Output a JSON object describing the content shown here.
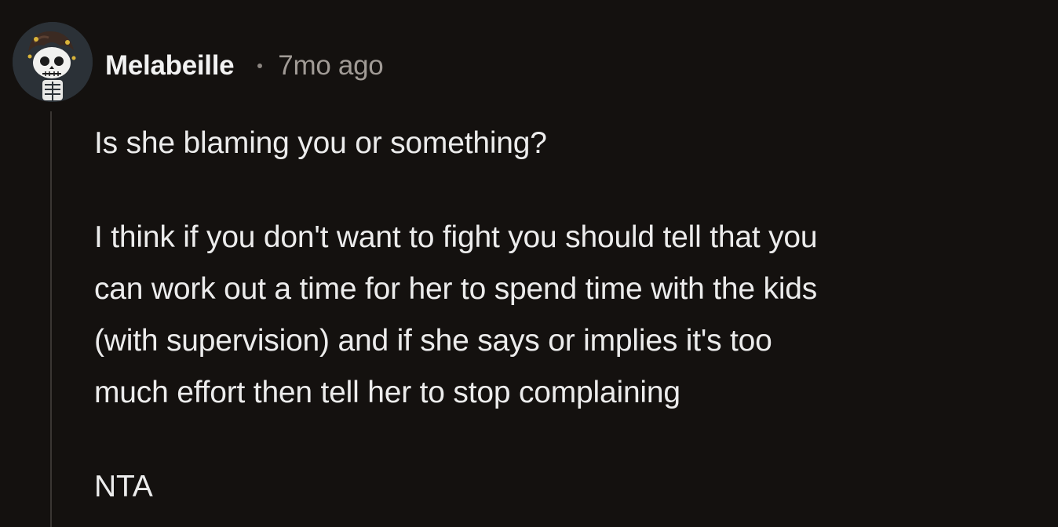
{
  "comment": {
    "author": "Melabeille",
    "age": "7mo ago",
    "lines": {
      "l1": "Is she blaming you or something?",
      "l2": "I think if you don't want to fight you should tell that you",
      "l3": "can work out a time for her to spend time with the kids",
      "l4": "(with supervision) and if she says or implies it's too",
      "l5": "much effort then tell her to stop complaining",
      "l6": "NTA"
    }
  },
  "icons": {
    "avatar": "skeleton-avatar-icon",
    "separator": "dot-separator-icon"
  },
  "colors": {
    "background": "#14110f",
    "text": "#ececec",
    "meta": "#a19b96",
    "thread_line": "#3a3633"
  }
}
